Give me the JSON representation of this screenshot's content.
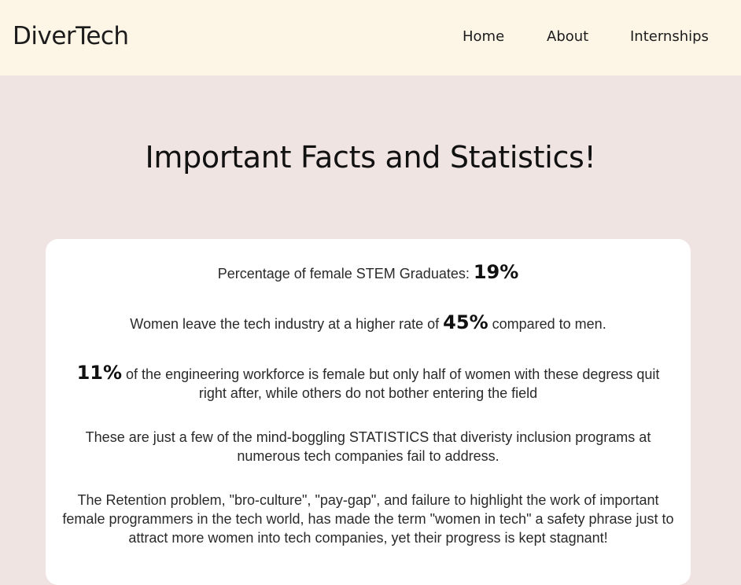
{
  "navbar": {
    "brand": "DiverTech",
    "links": [
      {
        "label": "Home"
      },
      {
        "label": "About"
      },
      {
        "label": "Internships"
      }
    ]
  },
  "main": {
    "title": "Important Facts and Statistics!",
    "facts": {
      "f1": {
        "before": "Percentage of female STEM Graduates: ",
        "stat": "19%",
        "after": ""
      },
      "f2": {
        "before": "Women leave the tech industry at a higher rate of ",
        "stat": "45%",
        "after": " compared to men."
      },
      "f3": {
        "before": "",
        "stat": "11%",
        "after": " of the engineering workforce is female but only half of women with these degress quit right after, while others do not bother entering the field"
      },
      "f4": {
        "text": "These are just a few of the mind-boggling STATISTICS that diveristy inclusion programs at numerous tech companies fail to address."
      },
      "f5": {
        "text": "The Retention problem, \"bro-culture\", \"pay-gap\", and failure to highlight the work of important female programmers in the tech world, has made the term \"women in tech\" a safety phrase just to attract more women into tech companies, yet their progress is kept stagnant!"
      }
    }
  },
  "colors": {
    "navbar_bg": "#fdf5e6",
    "page_bg": "#efe4e1",
    "card_bg": "#ffffff",
    "text": "#1c1c1c"
  }
}
